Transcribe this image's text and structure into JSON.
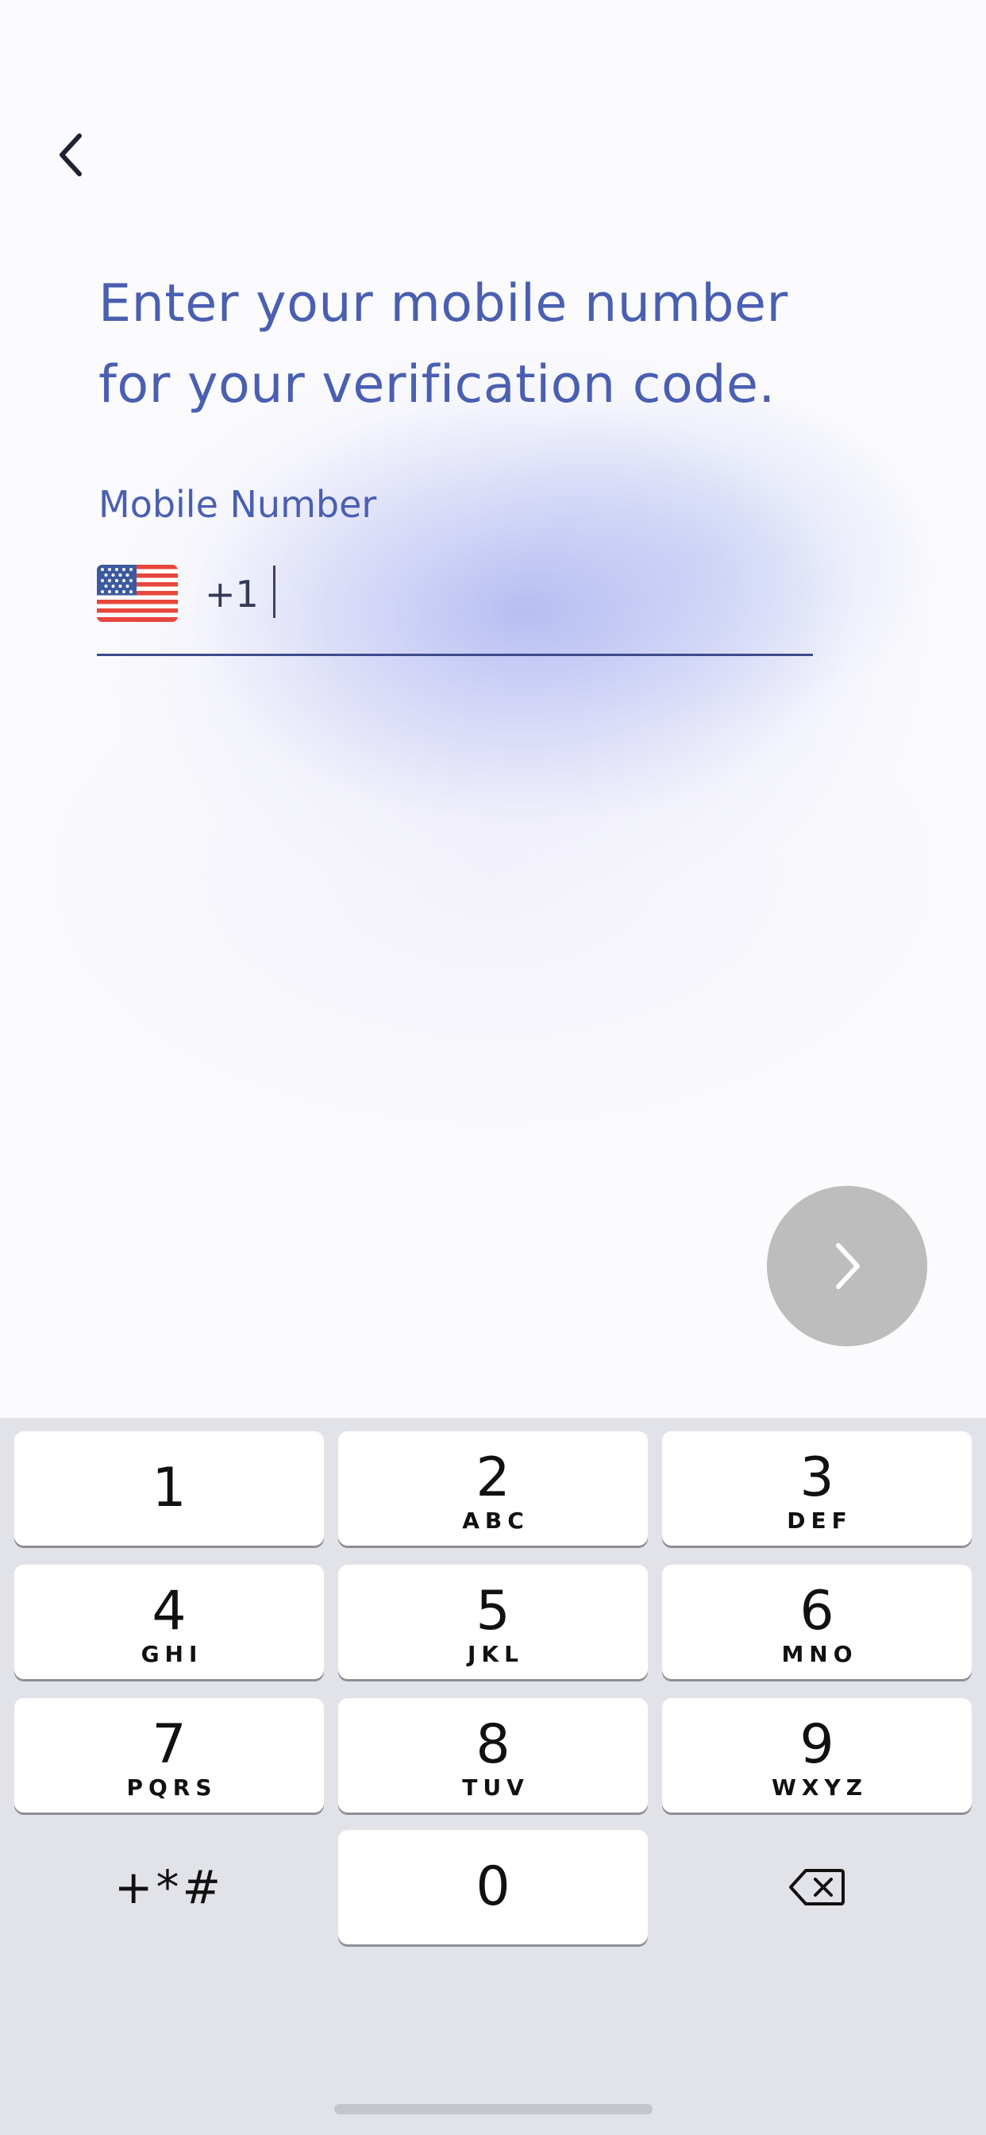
{
  "header": {
    "back_icon": "chevron-left-icon"
  },
  "title": {
    "line1": "Enter your mobile number",
    "line2": "for your verification code."
  },
  "phone_field": {
    "label": "Mobile Number",
    "country_flag_icon": "us-flag-icon",
    "country_code": "+1",
    "value": ""
  },
  "next_button": {
    "icon": "chevron-right-icon",
    "color": "#bdbdbd"
  },
  "keypad": {
    "keys": [
      {
        "digit": "1",
        "letters": ""
      },
      {
        "digit": "2",
        "letters": "ABC"
      },
      {
        "digit": "3",
        "letters": "DEF"
      },
      {
        "digit": "4",
        "letters": "GHI"
      },
      {
        "digit": "5",
        "letters": "JKL"
      },
      {
        "digit": "6",
        "letters": "MNO"
      },
      {
        "digit": "7",
        "letters": "PQRS"
      },
      {
        "digit": "8",
        "letters": "TUV"
      },
      {
        "digit": "9",
        "letters": "WXYZ"
      },
      {
        "digit": "0",
        "letters": ""
      }
    ],
    "symbols_label": "+*#",
    "delete_icon": "backspace-icon"
  },
  "colors": {
    "accent": "#4a5fb1",
    "underline": "#3f4a8c",
    "keyboard_bg": "#e2e3e8"
  }
}
